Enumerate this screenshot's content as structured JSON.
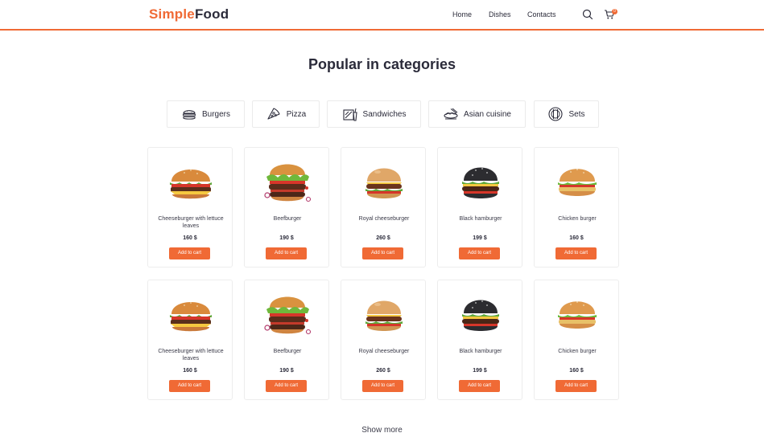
{
  "header": {
    "logo_part1": "Simple",
    "logo_part2": "Food",
    "nav": [
      "Home",
      "Dishes",
      "Contacts"
    ],
    "cart_count": "0"
  },
  "colors": {
    "accent": "#f06a35",
    "text": "#2b2b3a",
    "border": "#ebebeb"
  },
  "section_title": "Popular in categories",
  "categories": [
    {
      "label": "Burgers",
      "icon": "burger-icon"
    },
    {
      "label": "Pizza",
      "icon": "pizza-icon"
    },
    {
      "label": "Sandwiches",
      "icon": "sandwich-icon"
    },
    {
      "label": "Asian cuisine",
      "icon": "asian-cuisine-icon"
    },
    {
      "label": "Sets",
      "icon": "sets-icon"
    }
  ],
  "products": [
    {
      "name": "Cheeseburger with lettuce leaves",
      "price": "160 $",
      "button": "Add to cart"
    },
    {
      "name": "Beefburger",
      "price": "190 $",
      "button": "Add to cart"
    },
    {
      "name": "Royal cheeseburger",
      "price": "260 $",
      "button": "Add to cart"
    },
    {
      "name": "Black hamburger",
      "price": "199 $",
      "button": "Add to cart"
    },
    {
      "name": "Chicken burger",
      "price": "160 $",
      "button": "Add to cart"
    },
    {
      "name": "Cheeseburger with lettuce leaves",
      "price": "160 $",
      "button": "Add to cart"
    },
    {
      "name": "Beefburger",
      "price": "190 $",
      "button": "Add to cart"
    },
    {
      "name": "Royal cheeseburger",
      "price": "260 $",
      "button": "Add to cart"
    },
    {
      "name": "Black hamburger",
      "price": "199 $",
      "button": "Add to cart"
    },
    {
      "name": "Chicken burger",
      "price": "160 $",
      "button": "Add to cart"
    }
  ],
  "show_more": "Show more"
}
